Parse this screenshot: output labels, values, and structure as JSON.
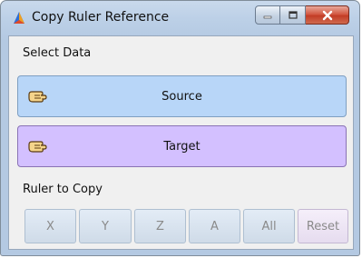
{
  "window": {
    "title": "Copy Ruler Reference",
    "icon": "app-logo-icon"
  },
  "caption_buttons": {
    "minimize_icon": "minimize-icon",
    "maximize_icon": "maximize-icon",
    "close_icon": "close-icon"
  },
  "select_data": {
    "label": "Select Data",
    "source_label": "Source",
    "target_label": "Target",
    "button_icon": "pointing-hand-icon"
  },
  "ruler": {
    "label": "Ruler to Copy",
    "buttons": [
      "X",
      "Y",
      "Z",
      "A",
      "All",
      "Reset"
    ]
  },
  "colors": {
    "source_button": "#b8d6f8",
    "target_button": "#d3c0ff",
    "close_button": "#c8432b"
  }
}
